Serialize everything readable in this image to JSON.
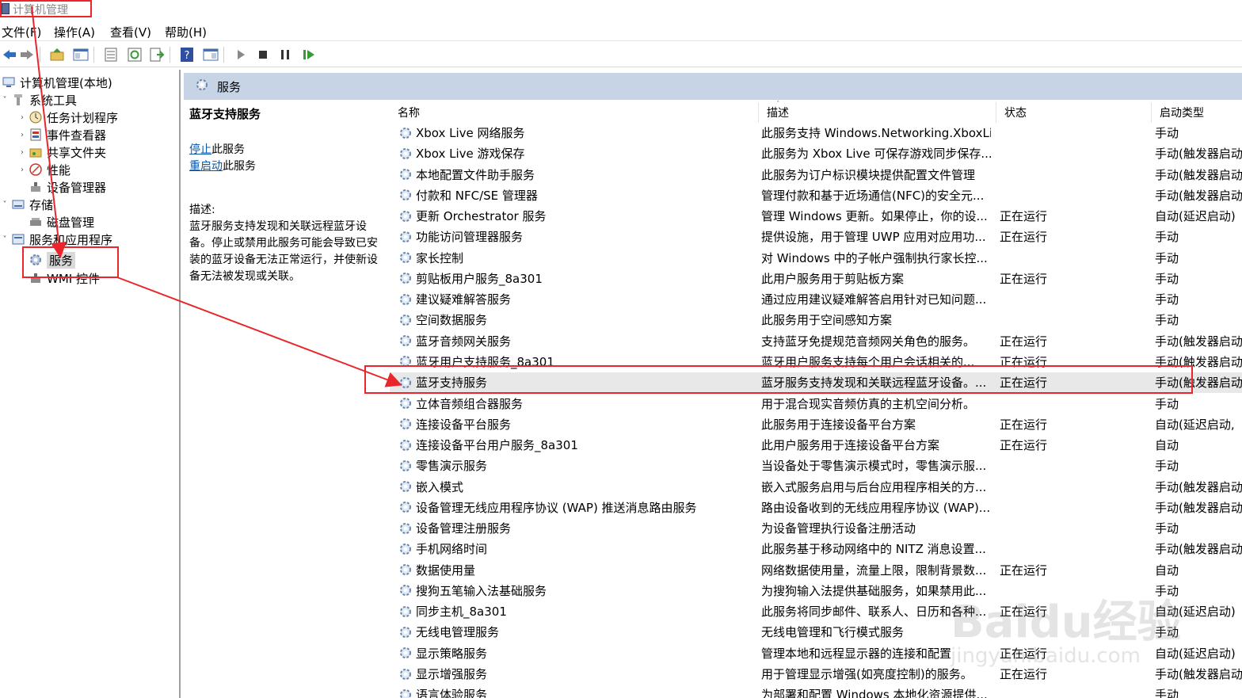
{
  "window": {
    "title": "计算机管理"
  },
  "menu": [
    "文件(F)",
    "操作(A)",
    "查看(V)",
    "帮助(H)"
  ],
  "toolbar": [
    "back",
    "forward",
    "up",
    "show-hide-tree",
    "properties",
    "refresh",
    "export",
    "help",
    "show-hide-action",
    "start",
    "stop",
    "pause",
    "restart"
  ],
  "tree": [
    {
      "label": "计算机管理(本地)",
      "level": 0,
      "expanded": true
    },
    {
      "label": "系统工具",
      "level": 1,
      "expanded": true
    },
    {
      "label": "任务计划程序",
      "level": 2,
      "expanded": false
    },
    {
      "label": "事件查看器",
      "level": 2,
      "expanded": false
    },
    {
      "label": "共享文件夹",
      "level": 2,
      "expanded": false
    },
    {
      "label": "性能",
      "level": 2,
      "expanded": false
    },
    {
      "label": "设备管理器",
      "level": 2,
      "expanded": null
    },
    {
      "label": "存储",
      "level": 1,
      "expanded": true
    },
    {
      "label": "磁盘管理",
      "level": 2,
      "expanded": null
    },
    {
      "label": "服务和应用程序",
      "level": 1,
      "expanded": true
    },
    {
      "label": "服务",
      "level": 2,
      "expanded": null,
      "selected": true
    },
    {
      "label": "WMI 控件",
      "level": 2,
      "expanded": null
    }
  ],
  "header": {
    "title": "服务"
  },
  "detail": {
    "service_name": "蓝牙支持服务",
    "stop_link": "停止",
    "stop_suffix": "此服务",
    "restart_link": "重启动",
    "restart_suffix": "此服务",
    "desc_label": "描述:",
    "description": "蓝牙服务支持发现和关联远程蓝牙设备。停止或禁用此服务可能会导致已安装的蓝牙设备无法正常运行，并使新设备无法被发现或关联。"
  },
  "columns": {
    "name": "名称",
    "desc": "描述",
    "status": "状态",
    "startup": "启动类型"
  },
  "services": [
    {
      "name": "Xbox Live 网络服务",
      "desc": "此服务支持 Windows.Networking.XboxLi...",
      "status": "",
      "startup": "手动"
    },
    {
      "name": "Xbox Live 游戏保存",
      "desc": "此服务为 Xbox Live 可保存游戏同步保存...",
      "status": "",
      "startup": "手动(触发器启动"
    },
    {
      "name": "本地配置文件助手服务",
      "desc": "此服务为订户标识模块提供配置文件管理",
      "status": "",
      "startup": "手动(触发器启动"
    },
    {
      "name": "付款和 NFC/SE 管理器",
      "desc": "管理付款和基于近场通信(NFC)的安全元...",
      "status": "",
      "startup": "手动(触发器启动"
    },
    {
      "name": "更新 Orchestrator 服务",
      "desc": "管理 Windows 更新。如果停止，你的设...",
      "status": "正在运行",
      "startup": "自动(延迟启动)"
    },
    {
      "name": "功能访问管理器服务",
      "desc": "提供设施，用于管理 UWP 应用对应用功...",
      "status": "正在运行",
      "startup": "手动"
    },
    {
      "name": "家长控制",
      "desc": "对 Windows 中的子帐户强制执行家长控...",
      "status": "",
      "startup": "手动"
    },
    {
      "name": "剪贴板用户服务_8a301",
      "desc": "此用户服务用于剪贴板方案",
      "status": "正在运行",
      "startup": "手动"
    },
    {
      "name": "建议疑难解答服务",
      "desc": "通过应用建议疑难解答启用针对已知问题...",
      "status": "",
      "startup": "手动"
    },
    {
      "name": "空间数据服务",
      "desc": "此服务用于空间感知方案",
      "status": "",
      "startup": "手动"
    },
    {
      "name": "蓝牙音频网关服务",
      "desc": "支持蓝牙免提规范音频网关角色的服务。",
      "status": "正在运行",
      "startup": "手动(触发器启动"
    },
    {
      "name": "蓝牙用户支持服务_8a301",
      "desc": "蓝牙用户服务支持每个用户会话相关的...",
      "status": "正在运行",
      "startup": "手动(触发器启动"
    },
    {
      "name": "蓝牙支持服务",
      "desc": "蓝牙服务支持发现和关联远程蓝牙设备。...",
      "status": "正在运行",
      "startup": "手动(触发器启动",
      "selected": true
    },
    {
      "name": "立体音频组合器服务",
      "desc": "用于混合现实音频仿真的主机空间分析。",
      "status": "",
      "startup": "手动"
    },
    {
      "name": "连接设备平台服务",
      "desc": "此服务用于连接设备平台方案",
      "status": "正在运行",
      "startup": "自动(延迟启动,"
    },
    {
      "name": "连接设备平台用户服务_8a301",
      "desc": "此用户服务用于连接设备平台方案",
      "status": "正在运行",
      "startup": "自动"
    },
    {
      "name": "零售演示服务",
      "desc": "当设备处于零售演示模式时，零售演示服...",
      "status": "",
      "startup": "手动"
    },
    {
      "name": "嵌入模式",
      "desc": "嵌入式服务启用与后台应用程序相关的方...",
      "status": "",
      "startup": "手动(触发器启动"
    },
    {
      "name": "设备管理无线应用程序协议 (WAP) 推送消息路由服务",
      "desc": "路由设备收到的无线应用程序协议 (WAP)...",
      "status": "",
      "startup": "手动(触发器启动"
    },
    {
      "name": "设备管理注册服务",
      "desc": "为设备管理执行设备注册活动",
      "status": "",
      "startup": "手动"
    },
    {
      "name": "手机网络时间",
      "desc": "此服务基于移动网络中的 NITZ 消息设置...",
      "status": "",
      "startup": "手动(触发器启动"
    },
    {
      "name": "数据使用量",
      "desc": "网络数据使用量，流量上限，限制背景数...",
      "status": "正在运行",
      "startup": "自动"
    },
    {
      "name": "搜狗五笔输入法基础服务",
      "desc": "为搜狗输入法提供基础服务，如果禁用此...",
      "status": "",
      "startup": "手动"
    },
    {
      "name": "同步主机_8a301",
      "desc": "此服务将同步邮件、联系人、日历和各种...",
      "status": "正在运行",
      "startup": "自动(延迟启动)"
    },
    {
      "name": "无线电管理服务",
      "desc": "无线电管理和飞行模式服务",
      "status": "",
      "startup": "手动"
    },
    {
      "name": "显示策略服务",
      "desc": "管理本地和远程显示器的连接和配置",
      "status": "正在运行",
      "startup": "自动(延迟启动)"
    },
    {
      "name": "显示增强服务",
      "desc": "用于管理显示增强(如亮度控制)的服务。",
      "status": "正在运行",
      "startup": "手动(触发器启动"
    },
    {
      "name": "语言体验服务",
      "desc": "为部署和配置 Windows 本地化资源提供...",
      "status": "",
      "startup": "手动"
    }
  ],
  "watermark": {
    "logo": "Baidu经验",
    "url": "jingyan.baidu.com"
  },
  "colors": {
    "header_bar": "#c6d4e6",
    "annotation_red": "#e8262b",
    "link": "#0a56a8"
  }
}
